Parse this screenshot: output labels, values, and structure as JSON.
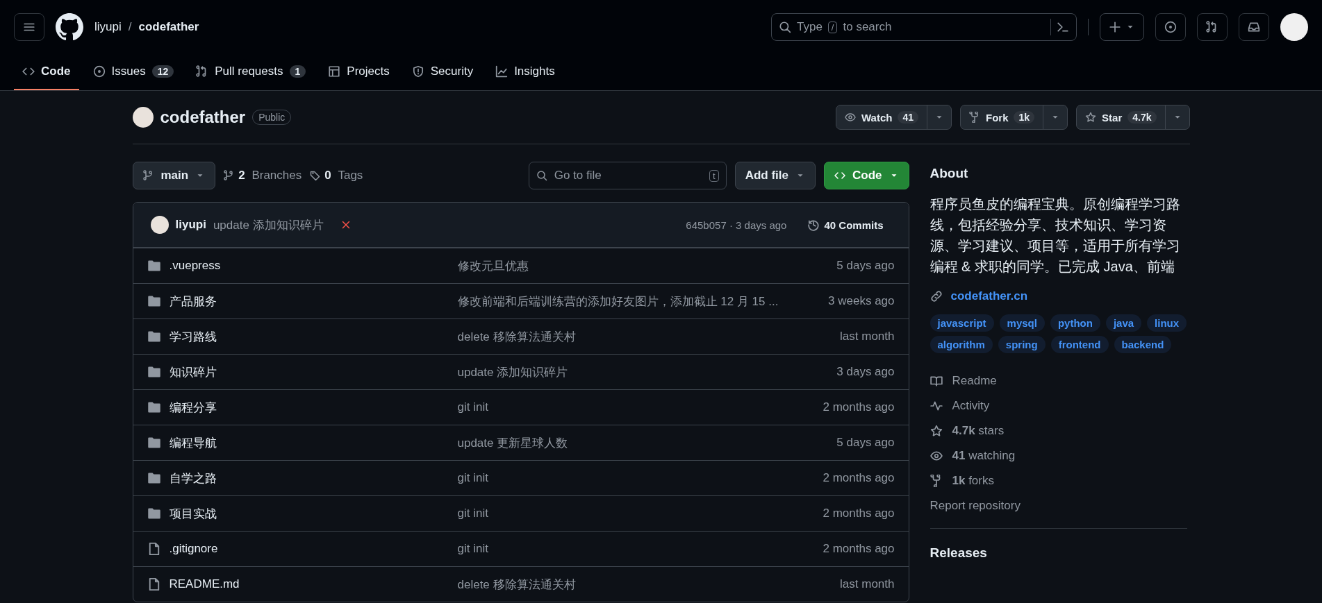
{
  "header": {
    "owner": "liyupi",
    "separator": "/",
    "repo": "codefather",
    "search": {
      "before": "Type",
      "key": "/",
      "after": "to search"
    }
  },
  "tabs": [
    {
      "kind": "code",
      "label": "Code",
      "selected": true
    },
    {
      "kind": "issue",
      "label": "Issues",
      "count": "12",
      "selected": false
    },
    {
      "kind": "pr",
      "label": "Pull requests",
      "count": "1",
      "selected": false
    },
    {
      "kind": "table",
      "label": "Projects",
      "selected": false
    },
    {
      "kind": "shield",
      "label": "Security",
      "selected": false
    },
    {
      "kind": "graph",
      "label": "Insights",
      "selected": false
    }
  ],
  "repo": {
    "name": "codefather",
    "visibility": "Public",
    "actions": [
      {
        "kind": "eye",
        "label": "Watch",
        "count": "41"
      },
      {
        "kind": "fork",
        "label": "Fork",
        "count": "1k"
      },
      {
        "kind": "star",
        "label": "Star",
        "count": "4.7k"
      }
    ]
  },
  "toolbar": {
    "branch": "main",
    "branches_count": "2",
    "branches_label": "Branches",
    "tags_count": "0",
    "tags_label": "Tags",
    "goto_placeholder": "Go to file",
    "goto_key": "t",
    "add_file": "Add file",
    "code": "Code"
  },
  "commit": {
    "author": "liyupi",
    "message": "update 添加知识碎片",
    "checks_failed": true,
    "hash_time": "645b057 · 3 days ago",
    "commits": "40 Commits"
  },
  "files": [
    {
      "kind": "folder",
      "name": ".vuepress",
      "message": "修改元旦优惠",
      "time": "5 days ago"
    },
    {
      "kind": "folder",
      "name": "产品服务",
      "message": "修改前端和后端训练营的添加好友图片，添加截止 12 月 15 ...",
      "time": "3 weeks ago"
    },
    {
      "kind": "folder",
      "name": "学习路线",
      "message": "delete 移除算法通关村",
      "time": "last month"
    },
    {
      "kind": "folder",
      "name": "知识碎片",
      "message": "update 添加知识碎片",
      "time": "3 days ago"
    },
    {
      "kind": "folder",
      "name": "编程分享",
      "message": "git init",
      "time": "2 months ago"
    },
    {
      "kind": "folder",
      "name": "编程导航",
      "message": "update 更新星球人数",
      "time": "5 days ago"
    },
    {
      "kind": "folder",
      "name": "自学之路",
      "message": "git init",
      "time": "2 months ago"
    },
    {
      "kind": "folder",
      "name": "项目实战",
      "message": "git init",
      "time": "2 months ago"
    },
    {
      "kind": "file",
      "name": ".gitignore",
      "message": "git init",
      "time": "2 months ago"
    },
    {
      "kind": "file",
      "name": "README.md",
      "message": "delete 移除算法通关村",
      "time": "last month"
    }
  ],
  "about": {
    "title": "About",
    "description": "程序员鱼皮的编程宝典。原创编程学习路线，包括经验分享、技术知识、学习资源、学习建议、项目等，适用于所有学习编程 & 求职的同学。已完成 Java、前端",
    "link": "codefather.cn",
    "topics": [
      "javascript",
      "mysql",
      "python",
      "java",
      "linux",
      "algorithm",
      "spring",
      "frontend",
      "backend"
    ],
    "stats": [
      {
        "kind": "book",
        "text": "Readme"
      },
      {
        "kind": "pulse",
        "text": "Activity"
      },
      {
        "kind": "star",
        "text": "**4.7k** stars"
      },
      {
        "kind": "eye",
        "text": "**41** watching"
      },
      {
        "kind": "fork",
        "text": "**1k** forks"
      }
    ],
    "report": "Report repository"
  },
  "releases": {
    "title": "Releases"
  }
}
